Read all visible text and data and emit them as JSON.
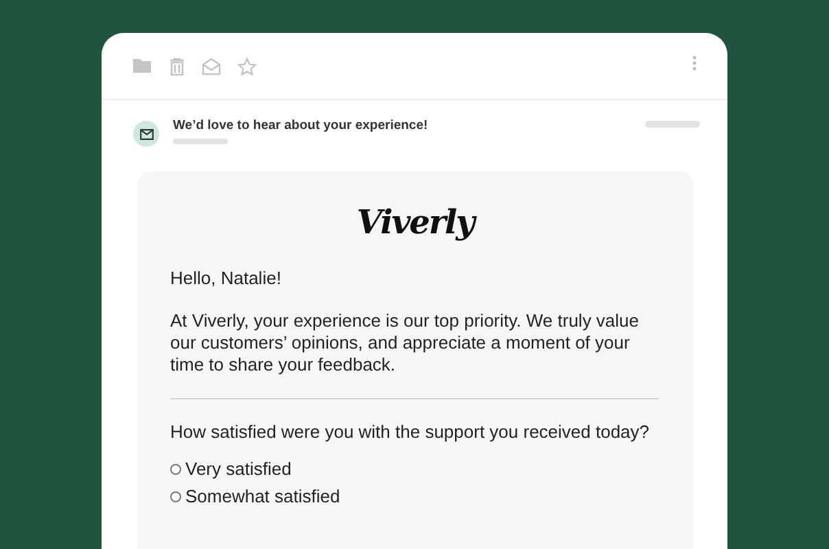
{
  "message": {
    "subject": "We’d love to hear about your experience!"
  },
  "email": {
    "logo": "Viverly",
    "greeting": "Hello, Natalie!",
    "body": "At Viverly, your experience is our top priority. We truly value our customers’ opinions, and appreciate a moment of your time to share your feedback.",
    "question": "How satisfied were you with the support you received today?",
    "options": [
      {
        "label": "Very satisfied",
        "selected": false
      },
      {
        "label": "Somewhat satisfied",
        "selected": false
      }
    ]
  }
}
